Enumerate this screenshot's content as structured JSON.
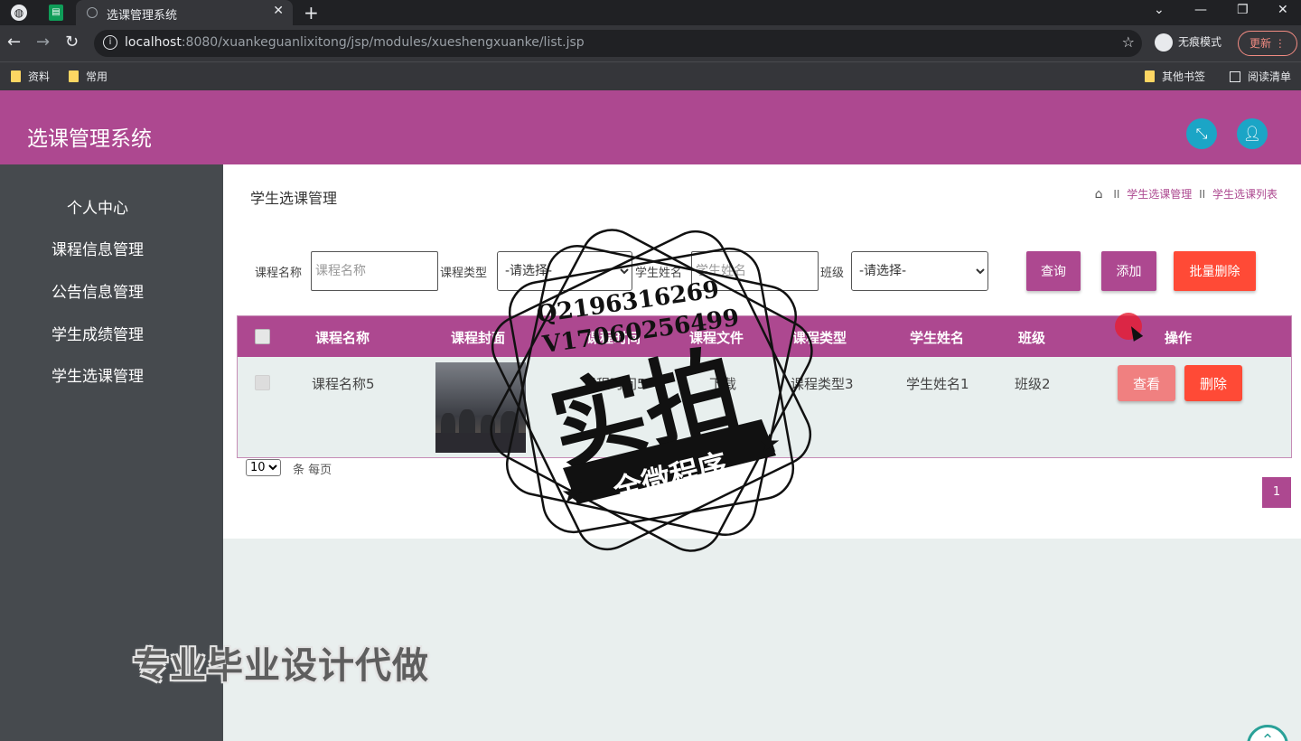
{
  "browser": {
    "tab_title": "选课管理系统",
    "tab_close": "✕",
    "new_tab": "+",
    "url_host": "localhost",
    "url_rest": ":8080/xuankeguanlixitong/jsp/modules/xueshengxuanke/list.jsp",
    "incognito_label": "无痕模式",
    "update_label": "更新",
    "bookmarks": [
      "资料",
      "常用"
    ],
    "bookmarks_right": [
      "其他书签",
      "阅读清单"
    ]
  },
  "app": {
    "title": "选课管理系统"
  },
  "sidebar": {
    "items": [
      {
        "label": "个人中心"
      },
      {
        "label": "课程信息管理"
      },
      {
        "label": "公告信息管理"
      },
      {
        "label": "学生成绩管理"
      },
      {
        "label": "学生选课管理"
      }
    ]
  },
  "page": {
    "title": "学生选课管理",
    "breadcrumb": [
      "学生选课管理",
      "学生选课列表"
    ],
    "breadcrumb_sep": "II"
  },
  "search": {
    "course_name_label": "课程名称",
    "course_name_placeholder": "课程名称",
    "course_type_label": "课程类型",
    "course_type_value": "-请选择-",
    "student_name_label": "学生姓名",
    "student_name_placeholder": "学生姓名",
    "class_label": "班级",
    "class_value": "-请选择-",
    "query_label": "查询",
    "add_label": "添加",
    "batch_delete_label": "批量删除"
  },
  "table": {
    "headers": [
      "课程名称",
      "课程封面",
      "课程时间",
      "课程文件",
      "课程类型",
      "学生姓名",
      "班级",
      "操作"
    ],
    "rows": [
      {
        "course_name": "课程名称5",
        "course_time": "课程时间5",
        "course_file": "下载",
        "course_type": "课程类型3",
        "student_name": "学生姓名1",
        "class": "班级2",
        "view_label": "查看",
        "delete_label": "删除"
      }
    ]
  },
  "pagination": {
    "page_size": "10",
    "per_page_label": "条 每页",
    "current_page": "1"
  },
  "overlay": {
    "stamp_line1": "Q2196316269",
    "stamp_line2": "V17060256499",
    "stamp_big": "实拍",
    "stamp_banner": "全微程序",
    "caption": "专业毕业设计代做"
  },
  "colors": {
    "primary": "#ad4890",
    "danger": "#ff4a36",
    "view": "#f08080",
    "sidebar": "#464a4e",
    "header_icon": "#1ba5c6"
  }
}
